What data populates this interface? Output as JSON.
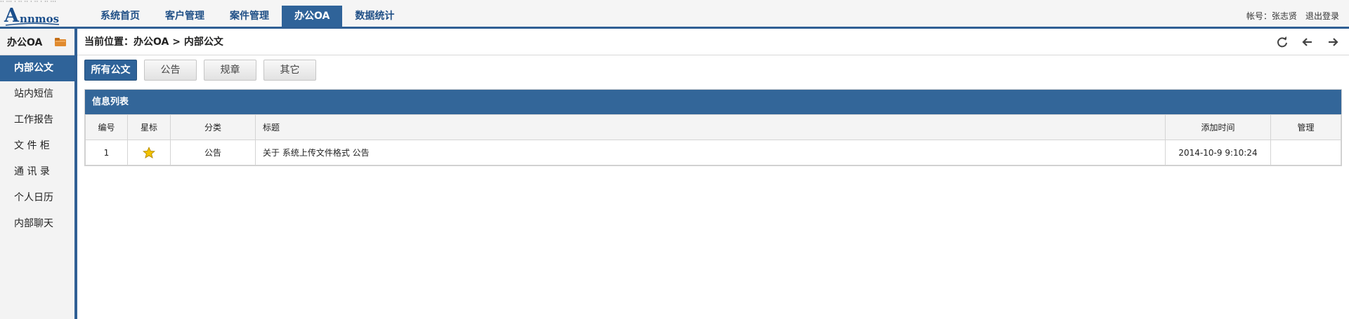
{
  "header": {
    "top_strip": "·· ··· · ·· ·· · ·· · ·· ···",
    "logo_initial": "A",
    "logo_rest": "nnmos",
    "nav": [
      {
        "label": "系统首页",
        "active": false
      },
      {
        "label": "客户管理",
        "active": false
      },
      {
        "label": "案件管理",
        "active": false
      },
      {
        "label": "办公OA",
        "active": true
      },
      {
        "label": "数据统计",
        "active": false
      }
    ],
    "account_label": "帐号：张志贤",
    "logout_label": "退出登录"
  },
  "sidebar": {
    "title": "办公OA",
    "items": [
      {
        "label": "内部公文",
        "active": true
      },
      {
        "label": "站内短信",
        "active": false
      },
      {
        "label": "工作报告",
        "active": false
      },
      {
        "label": "文 件 柜",
        "active": false
      },
      {
        "label": "通 讯 录",
        "active": false
      },
      {
        "label": "个人日历",
        "active": false
      },
      {
        "label": "内部聊天",
        "active": false
      }
    ]
  },
  "breadcrumb": "当前位置：办公OA > 内部公文",
  "tabs": [
    {
      "label": "所有公文",
      "active": true
    },
    {
      "label": "公告",
      "active": false
    },
    {
      "label": "规章",
      "active": false
    },
    {
      "label": "其它",
      "active": false
    }
  ],
  "panel": {
    "title": "信息列表",
    "columns": [
      "编号",
      "星标",
      "分类",
      "标题",
      "添加时间",
      "管理"
    ],
    "rows": [
      {
        "id": "1",
        "starred": true,
        "category": "公告",
        "title": "关于 系统上传文件格式 公告",
        "added": "2014-10-9 9:10:24",
        "manage": ""
      }
    ]
  },
  "icons": [
    "refresh-icon",
    "back-arrow-icon",
    "forward-arrow-icon",
    "folder-icon",
    "star-icon"
  ],
  "colors": {
    "primary": "#2f6399",
    "panel_header": "#336699",
    "star": "#f2c200"
  }
}
